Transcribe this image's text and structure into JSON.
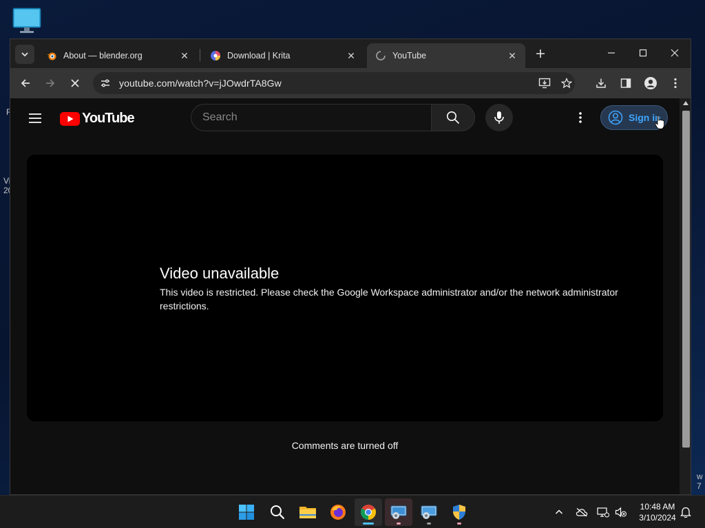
{
  "desktop": {
    "frag_r": "R",
    "frag_vi": "Vi",
    "frag_20": "20",
    "frag_w": "w",
    "frag_7": "7"
  },
  "browser": {
    "tabs": [
      {
        "title": "About — blender.org",
        "icon": "blender-icon"
      },
      {
        "title": "Download | Krita",
        "icon": "krita-icon"
      },
      {
        "title": "YouTube",
        "icon": "loading-spinner-icon"
      }
    ],
    "address": "youtube.com/watch?v=jJOwdrTA8Gw"
  },
  "youtube": {
    "logo_text": "YouTube",
    "search_placeholder": "Search",
    "sign_in": "Sign in",
    "error_title": "Video unavailable",
    "error_message": "This video is restricted. Please check the Google Workspace administrator and/or the network administrator restrictions.",
    "comments_status": "Comments are turned off"
  },
  "taskbar": {
    "time": "10:48 AM",
    "date": "3/10/2024"
  },
  "colors": {
    "yt_red": "#ff0000",
    "link_blue": "#3ea6ff",
    "active_indicator": "#4cc2ff",
    "running_indicator": "#e89cb0"
  }
}
